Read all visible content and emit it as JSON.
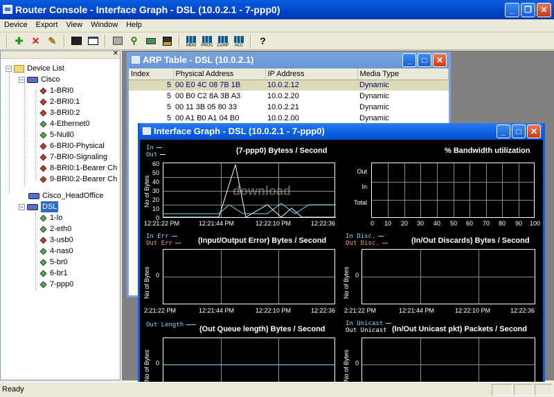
{
  "app": {
    "title": "Router Console - Interface Graph - DSL (10.0.2.1 - 7-ppp0)"
  },
  "menu": [
    "Device",
    "Export",
    "View",
    "Window",
    "Help"
  ],
  "toolbar": {
    "mem": "MEM",
    "proc": "PROC",
    "conf": "CONF",
    "acc": "ACC",
    "help": "?"
  },
  "tree": {
    "root": "Device List",
    "cisco": "Cisco",
    "cisco_items": [
      "1-BRI0",
      "2-BRI0:1",
      "3-BRI0:2",
      "4-Ethernet0",
      "5-Null0",
      "6-BRI0-Physical",
      "7-BRI0-Signaling",
      "8-BRI0:1-Bearer Ch",
      "9-BRI0:2-Bearer Ch"
    ],
    "headoffice": "Cisco_HeadOffice",
    "dsl": "DSL",
    "dsl_items": [
      "1-lo",
      "2-eth0",
      "3-usb0",
      "4-nas0",
      "5-br0",
      "6-br1",
      "7-ppp0"
    ]
  },
  "arp": {
    "title": "ARP Table - DSL (10.0.2.1)",
    "headers": [
      "Index",
      "Physical Address",
      "IP Address",
      "Media Type"
    ],
    "rows": [
      {
        "index": "5",
        "mac": "00 E0 4C 08 7B 1B",
        "ip": "10.0.2.12",
        "type": "Dynamic"
      },
      {
        "index": "5",
        "mac": "00 B0 C2 8A 3B A3",
        "ip": "10.0.2.20",
        "type": "Dynamic"
      },
      {
        "index": "5",
        "mac": "00 11 3B 05 80 33",
        "ip": "10.0.2.21",
        "type": "Dynamic"
      },
      {
        "index": "5",
        "mac": "00 A1 B0 A1 04 B0",
        "ip": "10.0.2.00",
        "type": "Dynamic"
      }
    ]
  },
  "graph": {
    "title": "Interface Graph - DSL (10.0.2.1 - 7-ppp0)",
    "g1": {
      "title": "(7-ppp0) Bytess / Second",
      "leg1": "In",
      "leg2": "Out",
      "ylabel": "No of Bytes",
      "yticks": [
        "60",
        "50",
        "40",
        "30",
        "20",
        "10",
        "0"
      ],
      "xticks": [
        "12:21:22 PM",
        "12:21:44 PM",
        "12:22:10 PM",
        "12:22:36"
      ]
    },
    "g2": {
      "title": "% Bandwidth utilization",
      "rows": [
        "Out",
        "In",
        "Total"
      ],
      "xticks": [
        "0",
        "10",
        "20",
        "30",
        "40",
        "50",
        "60",
        "70",
        "80",
        "90",
        "100"
      ]
    },
    "g3": {
      "title": "(Input/Output Error) Bytes / Second",
      "leg1": "In Err",
      "leg2": "Out Err",
      "ylabel": "No of Bytes",
      "ytick": "0",
      "xticks": [
        "2:21:22 PM",
        "12:21:44 PM",
        "12:22:10 PM",
        "12:22:36"
      ]
    },
    "g4": {
      "title": "(In/Out Discards) Bytes / Second",
      "leg1": "In Disc.",
      "leg2": "Out Disc.",
      "ylabel": "No of Bytes",
      "ytick": "0",
      "xticks": [
        "2:21:22 PM",
        "12:21:44 PM",
        "12:22:10 PM",
        "12:22:36"
      ]
    },
    "g5": {
      "title": "(Out Queue length) Bytes / Second",
      "leg1": "Out Length",
      "ylabel": "No of Bytes",
      "ytick": "0"
    },
    "g6": {
      "title": "(In/Out Unicast pkt) Packets / Second",
      "leg1": "In Unicast",
      "leg2": "Out Unicast",
      "ylabel": "No of Bytes",
      "ytick": "0"
    },
    "watermark": "download"
  },
  "status": {
    "text": "Ready"
  }
}
